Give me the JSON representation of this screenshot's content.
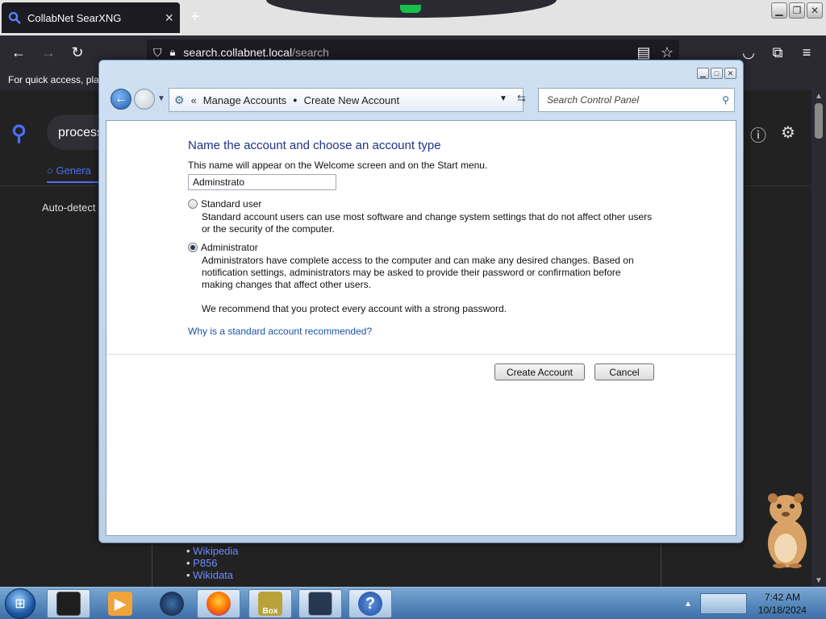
{
  "browser": {
    "tab_title": "CollabNet SearXNG",
    "tab_close": "×",
    "new_tab": "+",
    "url_host": "search.collabnet.local",
    "url_path": "/search",
    "bookmarks_text": "For quick access, plac"
  },
  "search_page": {
    "query": "process",
    "tab_general": "Genera",
    "autodetect": "Auto-detect",
    "links": [
      "Wikipedia",
      "P856",
      "Wikidata"
    ]
  },
  "control_panel": {
    "breadcrumb": [
      "Manage Accounts",
      "Create New Account"
    ],
    "search_placeholder": "Search Control Panel",
    "heading": "Name the account and choose an account type",
    "subheading": "This name will appear on the Welcome screen and on the Start menu.",
    "account_name_value": "Adminstrato",
    "options": [
      {
        "label": "Standard user",
        "checked": false,
        "description": "Standard account users can use most software and change system settings that do not affect other users or the security of the computer."
      },
      {
        "label": "Administrator",
        "checked": true,
        "description": "Administrators have complete access to the computer and can make any desired changes. Based on notification settings, administrators may be asked to provide their password or confirmation before making changes that affect other users."
      }
    ],
    "recommendation": "We recommend that you protect every account with a strong password.",
    "help_link": "Why is a standard account recommended?",
    "create_button": "Create Account",
    "cancel_button": "Cancel"
  },
  "taskbar": {
    "clock_time": "7:42 AM",
    "clock_date": "10/18/2024",
    "box_label": "Box",
    "help_glyph": "?"
  },
  "colors": {
    "heading_blue": "#1e3287",
    "link_blue": "#1c52a8",
    "searx_accent": "#4c6ef5"
  }
}
